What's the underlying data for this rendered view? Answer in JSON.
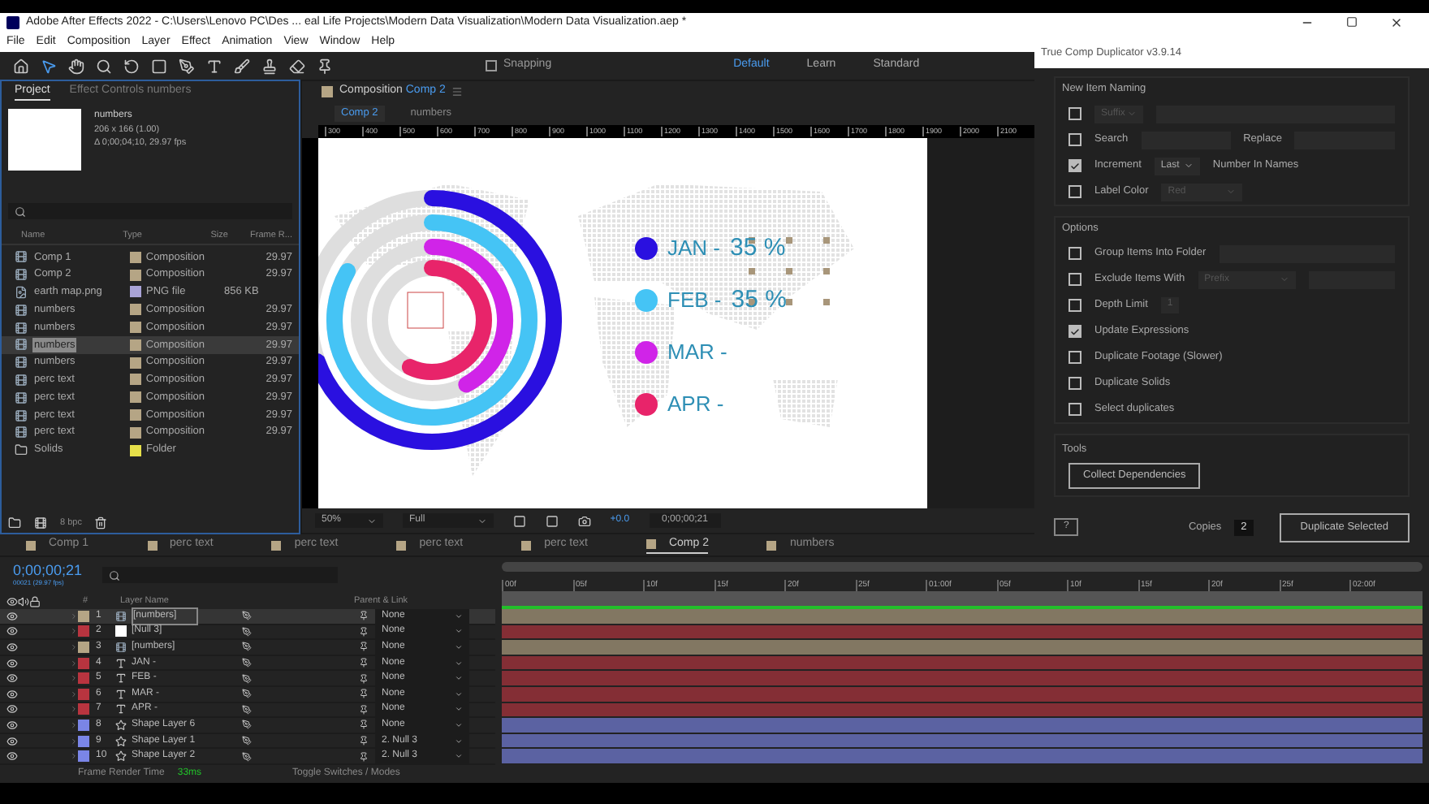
{
  "window": {
    "title": "Adobe After Effects 2022 - C:\\Users\\Lenovo PC\\Des ... eal Life Projects\\Modern Data Visualization\\Modern Data Visualization.aep *"
  },
  "menu": [
    "File",
    "Edit",
    "Composition",
    "Layer",
    "Effect",
    "Animation",
    "View",
    "Window",
    "Help"
  ],
  "toolbar": {
    "snapping": {
      "label": "Snapping",
      "checked": false
    },
    "workspaces": [
      {
        "label": "Default",
        "selected": true
      },
      {
        "label": "Learn",
        "selected": false
      },
      {
        "label": "Standard",
        "selected": false
      }
    ]
  },
  "project_panel": {
    "tabs": [
      {
        "label": "Project",
        "selected": true
      },
      {
        "label": "Effect Controls numbers",
        "selected": false
      }
    ],
    "preview": {
      "name": "numbers",
      "info": [
        "206 x 166 (1.00)",
        "Δ 0;00;04;10, 29.97 fps"
      ]
    },
    "columns": [
      "Name",
      "Type",
      "Size",
      "Frame R..."
    ],
    "items": [
      {
        "kind": "comp",
        "name": "Comp 1",
        "color": "#b5a585",
        "type": "Composition",
        "fps": "29.97",
        "selected": false
      },
      {
        "kind": "comp",
        "name": "Comp 2",
        "color": "#b5a585",
        "type": "Composition",
        "fps": "29.97",
        "selected": false
      },
      {
        "kind": "image",
        "name": "earth map.png",
        "color": "#a9a3d6",
        "type": "PNG file",
        "size": "856 KB",
        "selected": false
      },
      {
        "kind": "comp",
        "name": "numbers",
        "color": "#b5a585",
        "type": "Composition",
        "fps": "29.97",
        "selected": false
      },
      {
        "kind": "comp",
        "name": "numbers",
        "color": "#b5a585",
        "type": "Composition",
        "fps": "29.97",
        "selected": false
      },
      {
        "kind": "comp",
        "name": "numbers",
        "color": "#b5a585",
        "type": "Composition",
        "fps": "29.97",
        "selected": true
      },
      {
        "kind": "comp",
        "name": "numbers",
        "color": "#b5a585",
        "type": "Composition",
        "fps": "29.97",
        "selected": false
      },
      {
        "kind": "comp",
        "name": "perc text",
        "color": "#b5a585",
        "type": "Composition",
        "fps": "29.97",
        "selected": false
      },
      {
        "kind": "comp",
        "name": "perc text",
        "color": "#b5a585",
        "type": "Composition",
        "fps": "29.97",
        "selected": false
      },
      {
        "kind": "comp",
        "name": "perc text",
        "color": "#b5a585",
        "type": "Composition",
        "fps": "29.97",
        "selected": false
      },
      {
        "kind": "comp",
        "name": "perc text",
        "color": "#b5a585",
        "type": "Composition",
        "fps": "29.97",
        "selected": false
      },
      {
        "kind": "folder",
        "name": "Solids",
        "color": "#e6e04a",
        "type": "Folder",
        "selected": false
      }
    ],
    "bpc": "8 bpc"
  },
  "comp_panel": {
    "label": "Composition",
    "comp": "Comp 2",
    "breadcrumbs": [
      {
        "label": "Comp 2",
        "selected": true
      },
      {
        "label": "numbers",
        "selected": false
      }
    ],
    "ruler": [
      "300",
      "400",
      "500",
      "600",
      "700",
      "800",
      "900",
      "1000",
      "1100",
      "1200",
      "1300",
      "1400",
      "1500",
      "1600",
      "1700",
      "1800",
      "1900",
      "2000",
      "2100"
    ],
    "legend": [
      {
        "label": "JAN -",
        "value": "35 %",
        "color": "#2a10e0"
      },
      {
        "label": "FEB -",
        "value": "35 %",
        "color": "#45c4f5"
      },
      {
        "label": "MAR -",
        "color": "#d024e8"
      },
      {
        "label": "APR -",
        "color": "#e8246a"
      }
    ],
    "zoom": "50%",
    "resolution": "Full",
    "exposure": "+0.0",
    "timecode": "0;00;00;21"
  },
  "timeline": {
    "tabs": [
      {
        "label": "Comp 1",
        "selected": false
      },
      {
        "label": "perc text",
        "selected": false
      },
      {
        "label": "perc text",
        "selected": false
      },
      {
        "label": "perc text",
        "selected": false
      },
      {
        "label": "perc text",
        "selected": false
      },
      {
        "label": "Comp 2",
        "selected": true
      },
      {
        "label": "numbers",
        "selected": false
      }
    ],
    "timecode": "0;00;00;21",
    "frame_info": "00021 (29.97 fps)",
    "columns": [
      "#",
      "Layer Name",
      "Parent & Link"
    ],
    "ruler": [
      "00f",
      "05f",
      "10f",
      "15f",
      "20f",
      "25f",
      "01:00f",
      "05f",
      "10f",
      "15f",
      "20f",
      "25f",
      "02:00f"
    ],
    "layers": [
      {
        "num": "1",
        "kind": "comp",
        "name": "[numbers]",
        "color": "#b5a585",
        "parent": "None",
        "selected": true
      },
      {
        "num": "2",
        "kind": "solid",
        "name": "[Null 3]",
        "color": "#b8343f",
        "parent": "None",
        "selected": false
      },
      {
        "num": "3",
        "kind": "comp",
        "name": "[numbers]",
        "color": "#b5a585",
        "parent": "None",
        "selected": false
      },
      {
        "num": "4",
        "kind": "text",
        "name": "JAN -",
        "color": "#b8343f",
        "parent": "None",
        "selected": false
      },
      {
        "num": "5",
        "kind": "text",
        "name": "FEB -",
        "color": "#b8343f",
        "parent": "None",
        "selected": false
      },
      {
        "num": "6",
        "kind": "text",
        "name": "MAR -",
        "color": "#b8343f",
        "parent": "None",
        "selected": false
      },
      {
        "num": "7",
        "kind": "text",
        "name": "APR -",
        "color": "#b8343f",
        "parent": "None",
        "selected": false
      },
      {
        "num": "8",
        "kind": "shape",
        "name": "Shape Layer 6",
        "color": "#7a85e6",
        "parent": "None",
        "selected": false
      },
      {
        "num": "9",
        "kind": "shape",
        "name": "Shape Layer 1",
        "color": "#7a85e6",
        "parent": "2. Null 3",
        "selected": false
      },
      {
        "num": "10",
        "kind": "shape",
        "name": "Shape Layer 2",
        "color": "#7a85e6",
        "parent": "2. Null 3",
        "selected": false
      }
    ],
    "footer": {
      "render_label": "Frame Render Time",
      "render_time": "33ms",
      "toggle": "Toggle Switches / Modes"
    }
  },
  "dialog": {
    "title": "True Comp Duplicator v3.9.14",
    "sections": [
      {
        "title": "New Item Naming",
        "rows": [
          {
            "kind": "suffix",
            "checked": false,
            "dropdown": "Suffix"
          },
          {
            "kind": "search",
            "checked": false,
            "label": "Search",
            "label2": "Replace"
          },
          {
            "kind": "increment",
            "checked": true,
            "label": "Increment",
            "dropdown": "Last",
            "label2": "Number In Names"
          },
          {
            "kind": "color",
            "checked": false,
            "label": "Label Color",
            "dropdown": "Red"
          }
        ]
      },
      {
        "title": "Options",
        "rows": [
          {
            "kind": "field",
            "checked": false,
            "label": "Group Items Into Folder"
          },
          {
            "kind": "exclude",
            "checked": false,
            "label": "Exclude Items With",
            "dropdown": "Prefix"
          },
          {
            "kind": "number",
            "checked": false,
            "label": "Depth Limit",
            "value": "1"
          },
          {
            "kind": "plain",
            "checked": true,
            "label": "Update Expressions"
          },
          {
            "kind": "plain",
            "checked": false,
            "label": "Duplicate Footage (Slower)"
          },
          {
            "kind": "plain",
            "checked": false,
            "label": "Duplicate Solids"
          },
          {
            "kind": "plain",
            "checked": false,
            "label": "Select duplicates"
          }
        ]
      }
    ],
    "tools_title": "Tools",
    "tools_button": "Collect Dependencies",
    "help": "?",
    "copies_label": "Copies",
    "copies": "2",
    "action": "Duplicate Selected"
  }
}
